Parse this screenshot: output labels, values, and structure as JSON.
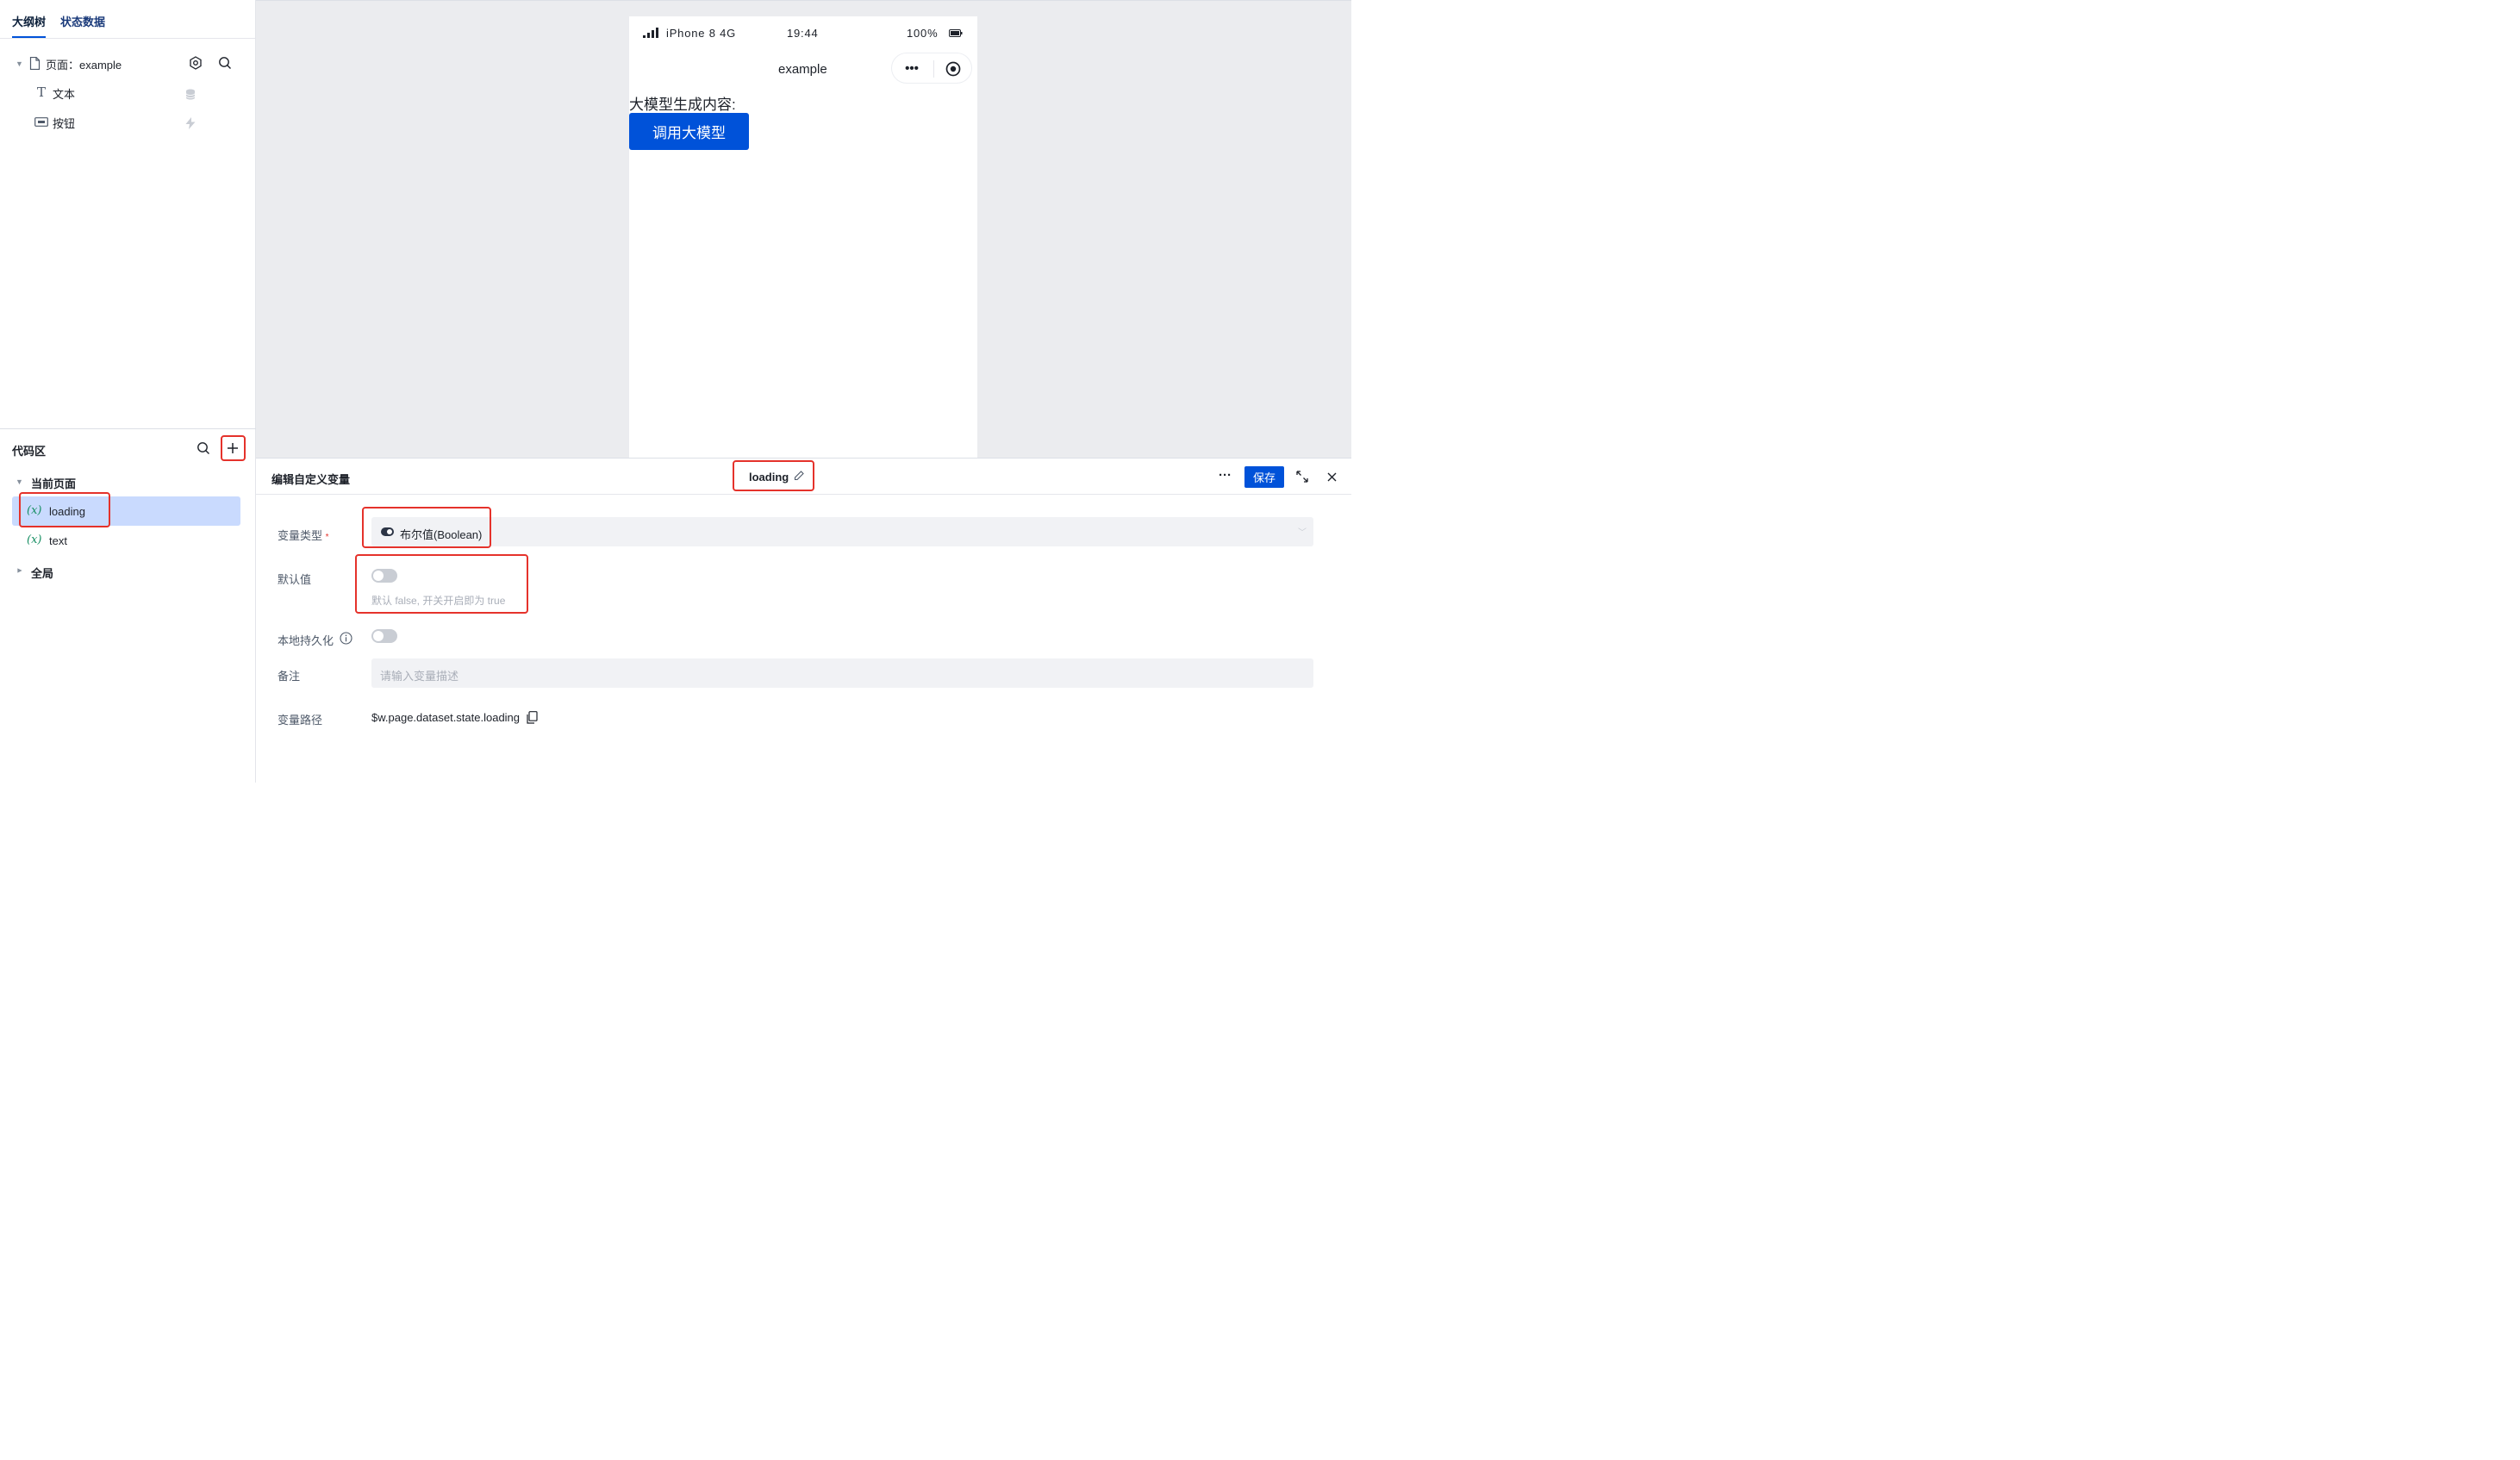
{
  "left": {
    "tabs": {
      "outline": "大纲树",
      "state": "状态数据"
    },
    "tree": {
      "page_label": "页面：example",
      "text_label": "文本",
      "button_label": "按钮"
    },
    "code": {
      "title": "代码区",
      "current_page": "当前页面",
      "vars": [
        "loading",
        "text"
      ],
      "var_icon": "(x)",
      "global": "全局"
    }
  },
  "phone": {
    "carrier": "iPhone 8  4G",
    "time": "19:44",
    "battery": "100%",
    "title": "example",
    "content_label": "大模型生成内容:",
    "button": "调用大模型"
  },
  "editor": {
    "title": "编辑自定义变量",
    "var_name": "loading",
    "save": "保存",
    "more": "···",
    "type_label": "变量类型",
    "required_mark": "*",
    "type_value": "布尔值(Boolean)",
    "default_label": "默认值",
    "default_hint": "默认 false, 开关开启即为 true",
    "persist_label": "本地持久化",
    "note_label": "备注",
    "note_placeholder": "请输入变量描述",
    "path_label": "变量路径",
    "path_value": "$w.page.dataset.state.loading"
  },
  "colors": {
    "accent": "#0052d9",
    "highlight": "#e5322b",
    "selected_row": "#c9dafe",
    "var_icon": "#168e62"
  }
}
